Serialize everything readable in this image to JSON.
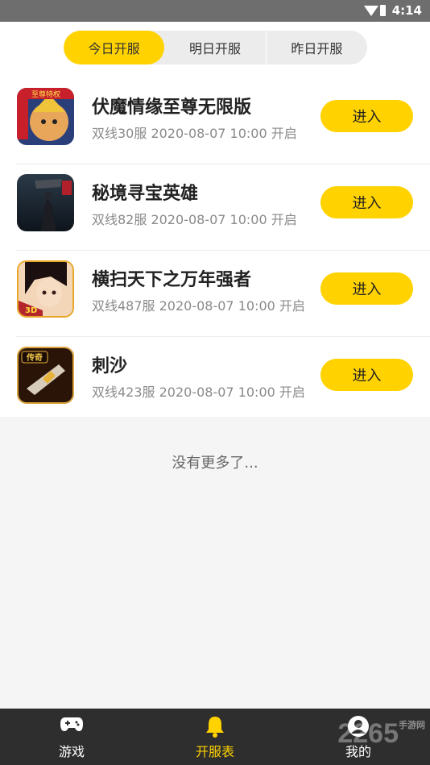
{
  "status_bar": {
    "time": "4:14"
  },
  "tabs": [
    {
      "label": "今日开服",
      "active": true
    },
    {
      "label": "明日开服",
      "active": false
    },
    {
      "label": "昨日开服",
      "active": false
    }
  ],
  "servers": [
    {
      "name": "伏魔情缘至尊无限版",
      "info": "双线30服 2020-08-07 10:00 开启",
      "button": "进入",
      "icon_caption": "至尊特权"
    },
    {
      "name": "秘境寻宝英雄",
      "info": "双线82服 2020-08-07 10:00 开启",
      "button": "进入",
      "icon_caption": ""
    },
    {
      "name": "横扫天下之万年强者",
      "info": "双线487服 2020-08-07 10:00 开启",
      "button": "进入",
      "icon_caption": "3D"
    },
    {
      "name": "刺沙",
      "info": "双线423服 2020-08-07 10:00 开启",
      "button": "进入",
      "icon_caption": "传奇"
    }
  ],
  "no_more_text": "没有更多了...",
  "bottom_nav": [
    {
      "label": "游戏",
      "icon": "gamepad-icon",
      "active": false
    },
    {
      "label": "开服表",
      "icon": "bell-icon",
      "active": true
    },
    {
      "label": "我的",
      "icon": "user-icon",
      "active": false
    }
  ],
  "watermark": {
    "main": "2265",
    "sub": "手游网"
  },
  "colors": {
    "accent": "#ffd200",
    "nav_bg": "#2e2e2e",
    "status_bg": "#6e6e6e"
  }
}
